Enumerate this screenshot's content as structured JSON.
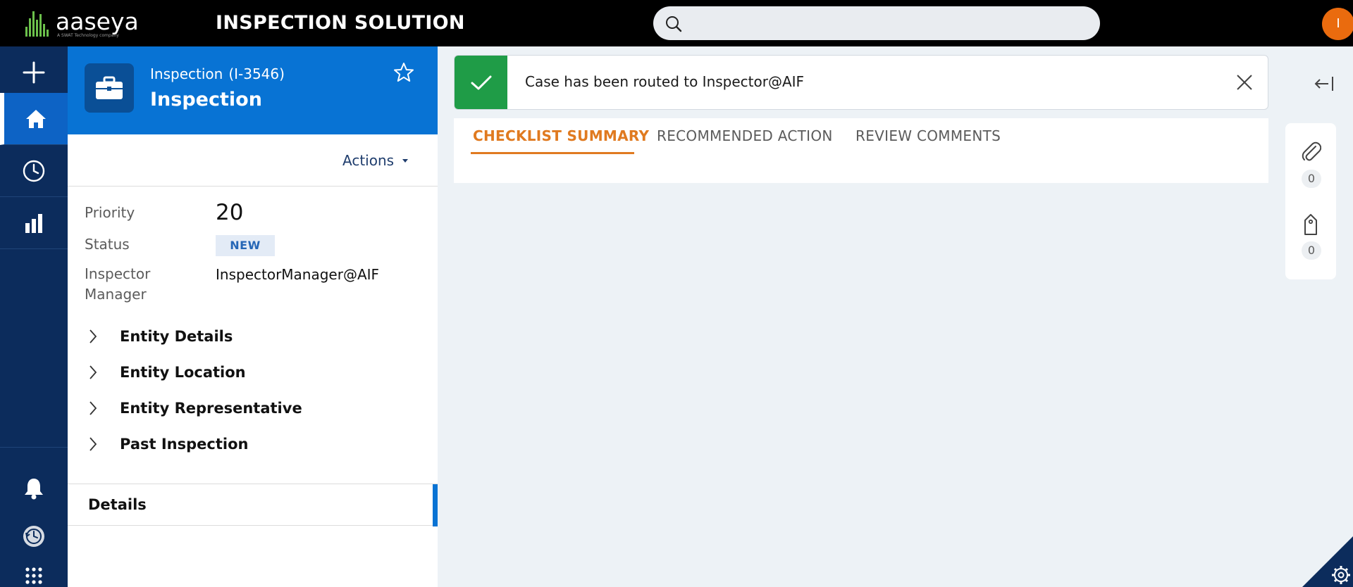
{
  "header": {
    "logo_text": "aaseya",
    "logo_subtext": "A SWAT Technology company",
    "app_title": "INSPECTION SOLUTION",
    "search_placeholder": "",
    "user_initial": "I"
  },
  "nav": {
    "items": [
      {
        "icon": "plus-icon"
      },
      {
        "icon": "home-icon",
        "active": true
      },
      {
        "icon": "clock-icon"
      },
      {
        "icon": "bar-chart-icon"
      },
      {
        "icon": "bell-icon"
      },
      {
        "icon": "history-icon"
      },
      {
        "icon": "apps-grid-icon"
      }
    ]
  },
  "case": {
    "type_label": "Inspection",
    "case_id": "(I-3546)",
    "title": "Inspection",
    "actions_label": "Actions",
    "fields": {
      "priority_label": "Priority",
      "priority_value": "20",
      "status_label": "Status",
      "status_value": "NEW",
      "manager_label_line1": "Inspector",
      "manager_label_line2": "Manager",
      "manager_value": "InspectorManager@AIF"
    },
    "sections": [
      "Entity Details",
      "Entity Location",
      "Entity Representative",
      "Past Inspection"
    ],
    "details_tab": "Details"
  },
  "toast": {
    "message": "Case has been routed to Inspector@AIF"
  },
  "tabs": [
    "CHECKLIST SUMMARY",
    "RECOMMENDED ACTION",
    "REVIEW COMMENTS"
  ],
  "utilities": {
    "attachments_count": "0",
    "tags_count": "0"
  },
  "colors": {
    "topbar": "#000000",
    "nav": "#0c2c5c",
    "brand_blue": "#0873d4",
    "accent_orange": "#e07a20",
    "success_green": "#1f9c47",
    "avatar": "#ea6b0e"
  }
}
